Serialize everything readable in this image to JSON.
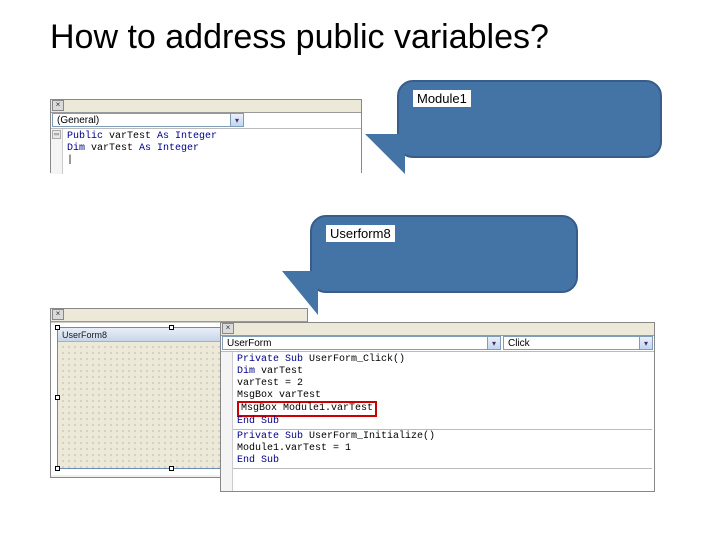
{
  "title": "How to address public variables?",
  "callouts": {
    "module": "Module1",
    "userform": "Userform8"
  },
  "module_pane": {
    "combo_object": "(General)",
    "code": {
      "l1_kw": "Public",
      "l1_rest": " varTest ",
      "l1_kw2": "As Integer",
      "l2_kw": "Dim",
      "l2_rest": " varTest ",
      "l2_kw2": "As Integer"
    }
  },
  "designer": {
    "form_caption": "UserForm8"
  },
  "ufcode_pane": {
    "combo_object": "UserForm",
    "combo_proc": "Click",
    "proc1": {
      "sig_kw": "Private Sub",
      "sig_rest": " UserForm_Click()",
      "l1_kw": "Dim",
      "l1_rest": " varTest",
      "l2": "varTest = 2",
      "l3": "MsgBox varTest",
      "l4": "MsgBox Module1.varTest",
      "end": "End Sub"
    },
    "proc2": {
      "sig_kw": "Private Sub",
      "sig_rest": " UserForm_Initialize()",
      "l1": "Module1.varTest = 1",
      "end": "End Sub"
    }
  }
}
